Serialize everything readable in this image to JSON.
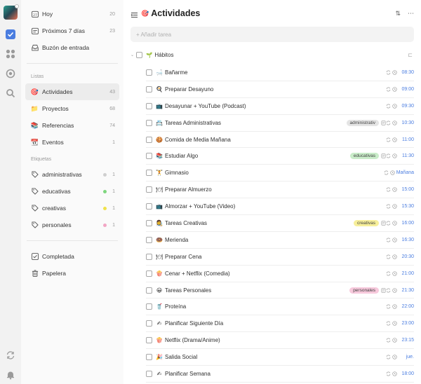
{
  "sidebar": {
    "smart": [
      {
        "label": "Hoy",
        "count": "20",
        "icon": "calendar-day-icon"
      },
      {
        "label": "Próximos 7 días",
        "count": "23",
        "icon": "calendar-week-icon"
      },
      {
        "label": "Buzón de entrada",
        "count": "",
        "icon": "inbox-icon"
      }
    ],
    "lists_title": "Listas",
    "lists": [
      {
        "label": "Actividades",
        "count": "43",
        "emoji": "🎯"
      },
      {
        "label": "Proyectos",
        "count": "68",
        "emoji": "📁"
      },
      {
        "label": "Referencias",
        "count": "74",
        "emoji": "📚"
      },
      {
        "label": "Eventos",
        "count": "1",
        "emoji": "📆"
      }
    ],
    "tags_title": "Etiquetas",
    "tags": [
      {
        "label": "administrativas",
        "count": "1",
        "color": "#cfcfcf"
      },
      {
        "label": "educativas",
        "count": "1",
        "color": "#7ed67e"
      },
      {
        "label": "creativas",
        "count": "1",
        "color": "#f0e24a"
      },
      {
        "label": "personales",
        "count": "1",
        "color": "#f2a6c4"
      }
    ],
    "bottom": [
      {
        "label": "Completada",
        "icon": "check-square-icon"
      },
      {
        "label": "Papelera",
        "icon": "trash-icon"
      }
    ]
  },
  "header": {
    "emoji": "🎯",
    "title": "Actividades"
  },
  "add_placeholder": "+ Añadir tarea",
  "group": {
    "emoji": "🌱",
    "name": "Hábitos"
  },
  "tasks": [
    {
      "emoji": "🛁",
      "name": "Bañarme",
      "time": "08:30",
      "tag": "",
      "tag_color": ""
    },
    {
      "emoji": "🍳",
      "name": "Preparar Desayuno",
      "time": "09:00",
      "tag": "",
      "tag_color": ""
    },
    {
      "emoji": "📺",
      "name": "Desayunar + YouTube (Podcast)",
      "time": "09:30",
      "tag": "",
      "tag_color": ""
    },
    {
      "emoji": "📇",
      "name": "Tareas Administrativas",
      "time": "10:30",
      "tag": "administrativ",
      "tag_color": "#e4e4e4"
    },
    {
      "emoji": "🍪",
      "name": "Comida de Media Mañana",
      "time": "11:00",
      "tag": "",
      "tag_color": ""
    },
    {
      "emoji": "📚",
      "name": "Estudiar Algo",
      "time": "11:30",
      "tag": "educativas",
      "tag_color": "#c9ecc9"
    },
    {
      "emoji": "🏋",
      "name": "Gimnasio",
      "time": "Mañana",
      "tag": "",
      "tag_color": ""
    },
    {
      "emoji": "🍽",
      "name": "Preparar Almuerzo",
      "time": "15:00",
      "tag": "",
      "tag_color": ""
    },
    {
      "emoji": "📺",
      "name": "Almorzar + YouTube (Video)",
      "time": "15:30",
      "tag": "",
      "tag_color": ""
    },
    {
      "emoji": "👩‍🎨",
      "name": "Tareas Creativas",
      "time": "16:00",
      "tag": "creativas",
      "tag_color": "#f7ef9a"
    },
    {
      "emoji": "🍩",
      "name": "Merienda",
      "time": "16:30",
      "tag": "",
      "tag_color": ""
    },
    {
      "emoji": "🍽",
      "name": "Preparar Cena",
      "time": "20:30",
      "tag": "",
      "tag_color": ""
    },
    {
      "emoji": "🍿",
      "name": "Cenar + Netflix (Comedia)",
      "time": "21:00",
      "tag": "",
      "tag_color": ""
    },
    {
      "emoji": "😀",
      "name": "Tareas Personales",
      "time": "21:30",
      "tag": "personales",
      "tag_color": "#f7c9dc"
    },
    {
      "emoji": "🥤",
      "name": "Proteína",
      "time": "22:00",
      "tag": "",
      "tag_color": ""
    },
    {
      "emoji": "✍",
      "name": "Planificar Siguiente Día",
      "time": "23:00",
      "tag": "",
      "tag_color": ""
    },
    {
      "emoji": "🍿",
      "name": "Netflix (Drama/Anime)",
      "time": "23:15",
      "tag": "",
      "tag_color": ""
    },
    {
      "emoji": "🎉",
      "name": "Salida Social",
      "time": "jue.",
      "tag": "",
      "tag_color": ""
    },
    {
      "emoji": "✍",
      "name": "Planificar Semana",
      "time": "18:00",
      "tag": "",
      "tag_color": ""
    }
  ]
}
